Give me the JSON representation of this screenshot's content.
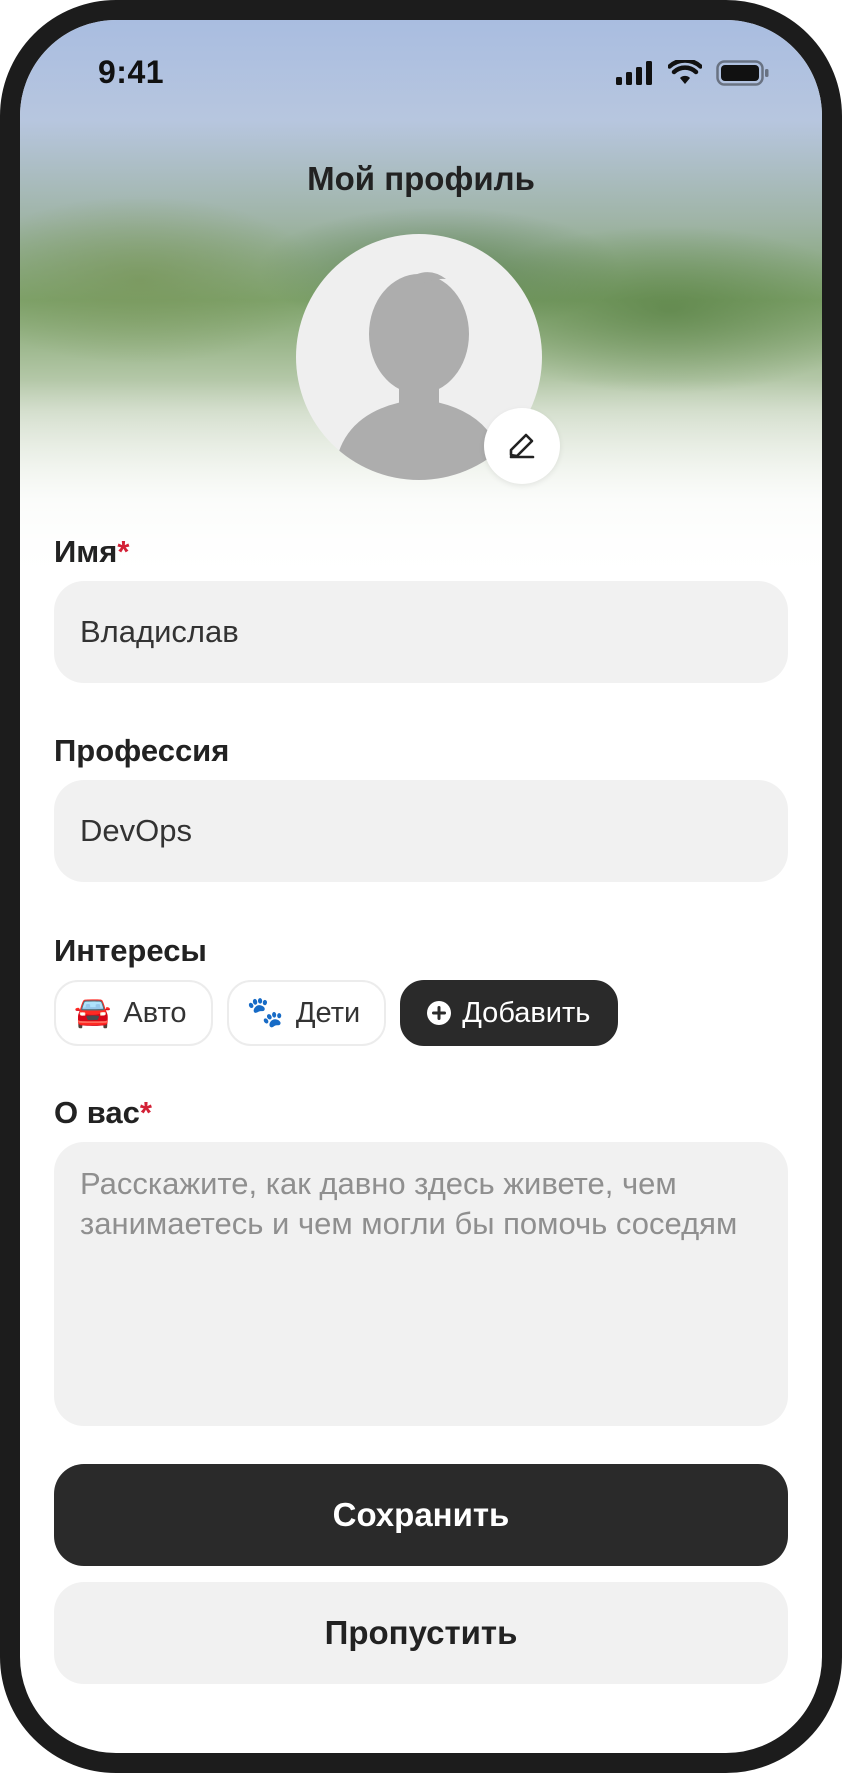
{
  "status_bar": {
    "time": "9:41",
    "icons": [
      "signal-icon",
      "wifi-icon",
      "battery-icon"
    ]
  },
  "header": {
    "title": "Мой профиль"
  },
  "avatar": {
    "icon": "person-placeholder-icon",
    "edit_icon": "pencil-icon"
  },
  "form": {
    "name": {
      "label": "Имя",
      "required_mark": "*",
      "value": "Владислав"
    },
    "profession": {
      "label": "Профессия",
      "value": "DevOps"
    },
    "interests": {
      "label": "Интересы",
      "chips": [
        {
          "emoji": "🚘",
          "label": "Авто",
          "icon": "car-icon"
        },
        {
          "emoji": "🐾",
          "label": "Дети",
          "icon": "paw-icon"
        }
      ],
      "add_label": "Добавить",
      "add_icon": "plus-circle-icon"
    },
    "about": {
      "label": "О вас",
      "required_mark": "*",
      "placeholder": "Расскажите, как давно здесь живете, чем занимаетесь и чем могли бы помочь соседям"
    }
  },
  "actions": {
    "save_label": "Сохранить",
    "skip_label": "Пропустить"
  },
  "colors": {
    "primary": "#2a2a2a",
    "field_bg": "#f1f1f1",
    "required": "#d32035"
  }
}
